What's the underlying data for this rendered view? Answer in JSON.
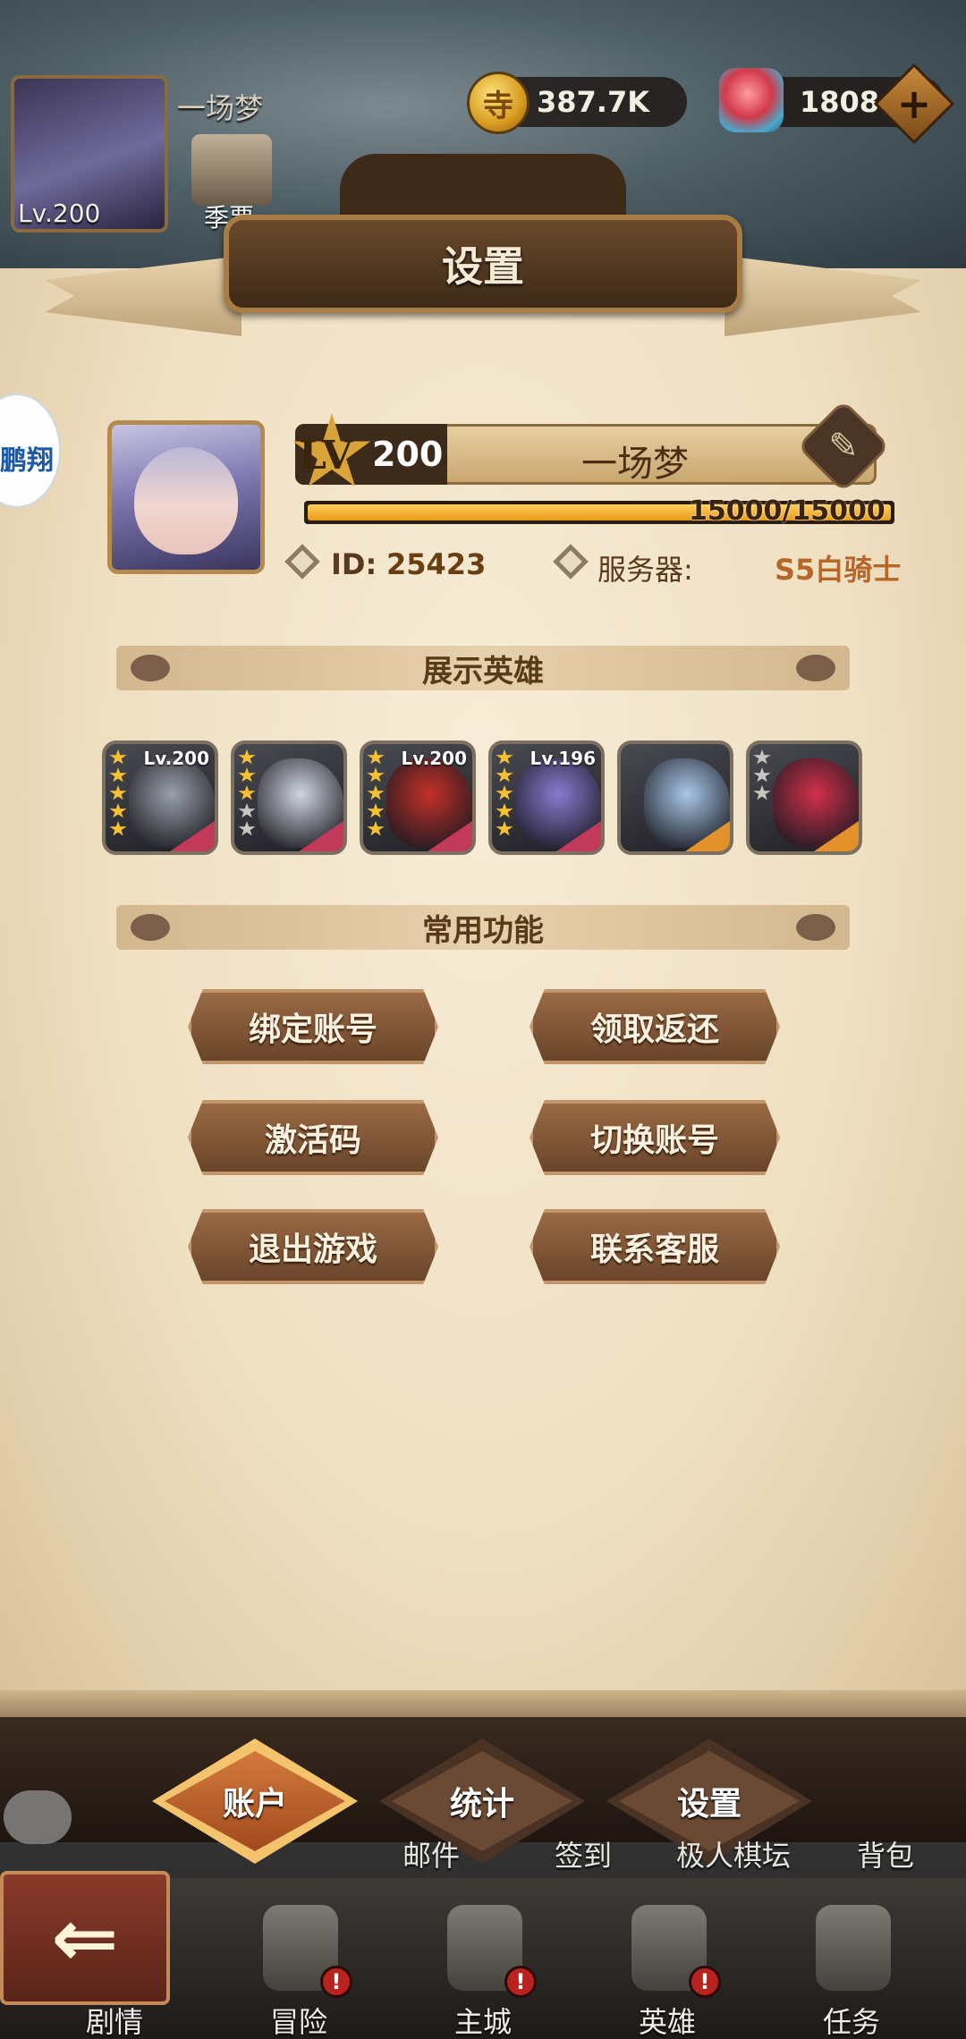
{
  "top": {
    "player_name": "一场梦",
    "player_level": "Lv.200",
    "gold": "387.7K",
    "coin_glyph": "寺",
    "gems": "1808",
    "season_label": "季票"
  },
  "side_logo": "鹏翔",
  "dialog": {
    "title": "设置",
    "profile": {
      "lv_badge": "LV",
      "level": "200",
      "name": "一场梦",
      "xp_text": "15000/15000",
      "xp_fraction": 1.0,
      "id_label": "ID:",
      "id_value": "25423",
      "server_label": "服务器:",
      "server_value": "S5白骑士"
    },
    "showcase_title": "展示英雄",
    "heroes": [
      {
        "level": "Lv.200",
        "stars": 5,
        "star_color": "gold",
        "art_color": "#9aa0a8",
        "rarity_color": "#c2395a"
      },
      {
        "level": "",
        "stars": 5,
        "star_color": "mixed",
        "art_color": "#cfd5de",
        "rarity_color": "#c2395a"
      },
      {
        "level": "Lv.200",
        "stars": 5,
        "star_color": "gold",
        "art_color": "#c23028",
        "rarity_color": "#c2395a"
      },
      {
        "level": "Lv.196",
        "stars": 5,
        "star_color": "gold",
        "art_color": "#8a7ad0",
        "rarity_color": "#c2395a"
      },
      {
        "level": "",
        "stars": 0,
        "star_color": "none",
        "art_color": "#a8c8e8",
        "rarity_color": "#e3912a"
      },
      {
        "level": "",
        "stars": 3,
        "star_color": "grey",
        "art_color": "#d0304a",
        "rarity_color": "#e3912a"
      }
    ],
    "functions_title": "常用功能",
    "buttons": {
      "bind_account": "绑定账号",
      "claim_rebate": "领取返还",
      "activation_code": "激活码",
      "switch_account": "切换账号",
      "exit_game": "退出游戏",
      "contact_support": "联系客服"
    }
  },
  "tabs": {
    "account": "账户",
    "stats": "统计",
    "settings": "设置"
  },
  "sub_labels": {
    "mail": "邮件",
    "checkin": "签到",
    "chess": "极人棋坛",
    "bag": "背包"
  },
  "nav": {
    "story": "剧情",
    "adventure": "冒险",
    "city": "主城",
    "hero": "英雄",
    "quest": "任务",
    "alert_glyph": "!"
  },
  "colors": {
    "accent": "#f3c46b",
    "parchment": "#f3e6cc",
    "button": "#7a5234"
  }
}
